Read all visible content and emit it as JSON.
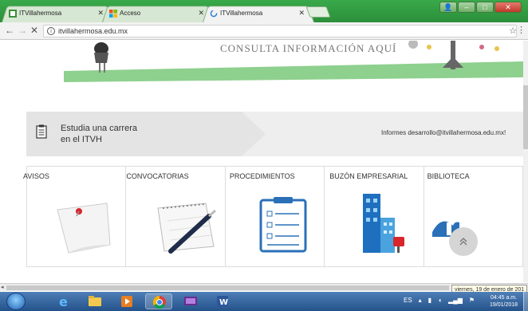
{
  "tabs": [
    {
      "title": "ITVillahermosa",
      "active": false
    },
    {
      "title": "Acceso",
      "active": false
    },
    {
      "title": "ITVillahermosa",
      "active": true
    }
  ],
  "address": {
    "url": "itvillahermosa.edu.mx"
  },
  "hero": {
    "text": "CONSULTA INFORMACIÓN AQUÍ"
  },
  "banner": {
    "cta_line1": "Estudia una carrera",
    "cta_line2": "en el ITVH",
    "info": "Informes desarrollo@itvillahermosa.edu.mx!"
  },
  "cards": [
    {
      "label": "AVISOS"
    },
    {
      "label": "CONVOCATORIAS"
    },
    {
      "label": "PROCEDIMIENTOS"
    },
    {
      "label": "BUZÓN EMPRESARIAL"
    },
    {
      "label": "BIBLIOTECA"
    }
  ],
  "status": {
    "date_tooltip": "viernes, 19 de enero de 201"
  },
  "taskbar": {
    "lang": "ES",
    "time": "04:45 a.m.",
    "date": "19/01/2018"
  },
  "colors": {
    "titlebar": "#2b8f3a",
    "hero_green": "#8ed08e",
    "taskbar": "#24518a"
  }
}
